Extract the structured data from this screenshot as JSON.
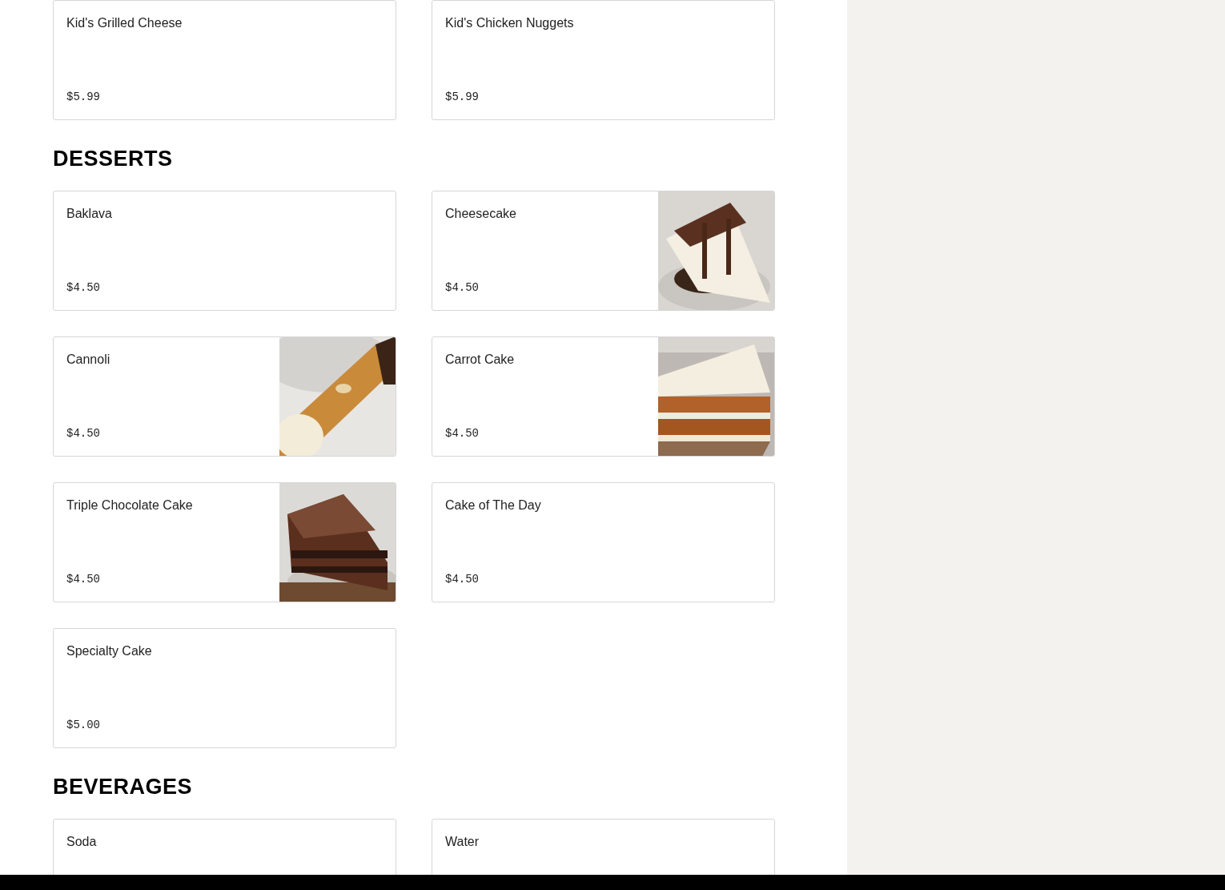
{
  "sections": [
    {
      "items": [
        {
          "name": "Kid's Grilled Cheese",
          "price": "$5.99",
          "kind": "plain"
        },
        {
          "name": "Kid's Chicken Nuggets",
          "price": "$5.99",
          "kind": "plain"
        }
      ]
    },
    {
      "title": "DESSERTS",
      "items": [
        {
          "name": "Baklava",
          "price": "$4.50",
          "kind": "plain"
        },
        {
          "name": "Cheesecake",
          "price": "$4.50",
          "kind": "picture"
        },
        {
          "name": "Cannoli",
          "price": "$4.50",
          "kind": "picture"
        },
        {
          "name": "Carrot Cake",
          "price": "$4.50",
          "kind": "picture"
        },
        {
          "name": "Triple Chocolate Cake",
          "price": "$4.50",
          "kind": "picture"
        },
        {
          "name": "Cake of The Day",
          "price": "$4.50",
          "kind": "plain"
        },
        {
          "name": "Specialty Cake",
          "price": "$5.00",
          "kind": "plain"
        }
      ]
    },
    {
      "title": "BEVERAGES",
      "items": [
        {
          "name": "Soda",
          "kind": "plain"
        },
        {
          "name": "Water",
          "kind": "plain"
        }
      ]
    }
  ]
}
